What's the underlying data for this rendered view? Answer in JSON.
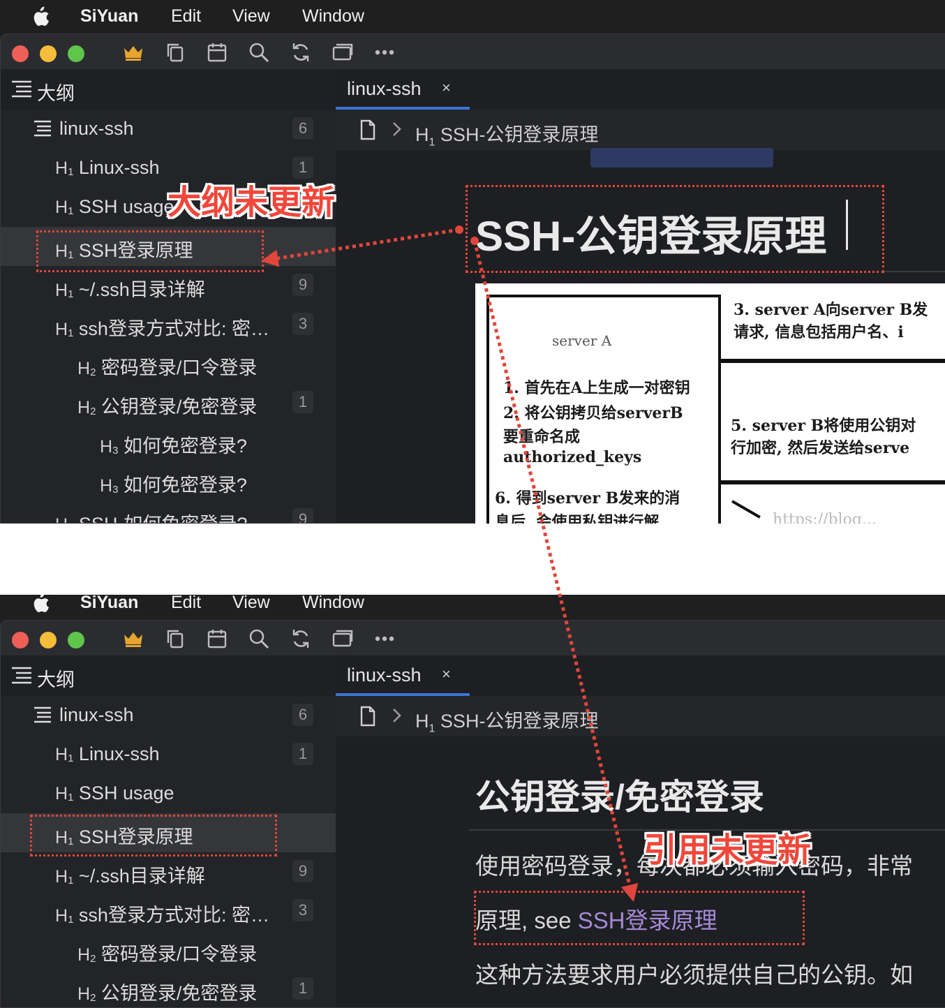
{
  "menubar": {
    "app_name": "SiYuan",
    "items": [
      "Edit",
      "View",
      "Window"
    ]
  },
  "toolbar": {
    "icons": [
      "crown-icon",
      "copy-icon",
      "calendar-icon",
      "search-icon",
      "sync-icon",
      "window-icon",
      "more-icon"
    ]
  },
  "sidebar": {
    "title": "大纲",
    "top_rows": [
      {
        "level": "doc",
        "label": "linux-ssh",
        "count": "6"
      },
      {
        "level": "H1",
        "label": "Linux-ssh",
        "count": "1"
      },
      {
        "level": "H1",
        "label": "SSH usage",
        "count": ""
      },
      {
        "level": "H1",
        "label": "SSH登录原理",
        "count": ""
      },
      {
        "level": "H1",
        "label": "~/.ssh目录详解",
        "count": "9"
      },
      {
        "level": "H1",
        "label": "ssh登录方式对比: 密…",
        "count": "3"
      },
      {
        "level": "H2",
        "label": "密码登录/口令登录",
        "count": ""
      },
      {
        "level": "H2",
        "label": "公钥登录/免密登录",
        "count": "1"
      },
      {
        "level": "H3",
        "label": "如何免密登录?",
        "count": ""
      },
      {
        "level": "H3",
        "label": "如何免密登录?",
        "count": ""
      },
      {
        "level": "H1",
        "label": "SSH-如何免密登录?",
        "count": "9"
      }
    ],
    "bottom_rows": [
      {
        "level": "doc",
        "label": "linux-ssh",
        "count": "6"
      },
      {
        "level": "H1",
        "label": "Linux-ssh",
        "count": "1"
      },
      {
        "level": "H1",
        "label": "SSH usage",
        "count": ""
      },
      {
        "level": "H1",
        "label": "SSH登录原理",
        "count": ""
      },
      {
        "level": "H1",
        "label": "~/.ssh目录详解",
        "count": "9"
      },
      {
        "level": "H1",
        "label": "ssh登录方式对比: 密…",
        "count": "3"
      },
      {
        "level": "H2",
        "label": "密码登录/口令登录",
        "count": ""
      },
      {
        "level": "H2",
        "label": "公钥登录/免密登录",
        "count": "1"
      }
    ]
  },
  "editor": {
    "tab_label": "linux-ssh",
    "tab_close": "×",
    "breadcrumb": "H1 SSH-公钥登录原理",
    "breadcrumb_level": "H",
    "breadcrumb_level_num": "1",
    "breadcrumb_text": "SSH-公钥登录原理",
    "top_heading": "SSH-公钥登录原理",
    "bottom_heading": "公钥登录/免密登录",
    "para1": "使用密码登录，每次都必须输入密码，非常",
    "para2_prefix": "原理, see ",
    "para2_ref": "SSH登录原理",
    "para3": "这种方法要求用户必须提供自己的公钥。如"
  },
  "figure": {
    "server_a": "server A",
    "step1": "1. 首先在A上生成一对密钥",
    "step2a": "2. 将公钥拷贝给serverB",
    "step2b": "要重命名成",
    "step2c": "authorized_keys",
    "step3a": "3. server A向server B发",
    "step3b": "请求, 信息包括用户名、i",
    "step5a": "5. server B将使用公钥对",
    "step5b": "行加密, 然后发送给serve",
    "step6a": "6. 得到server B发来的消",
    "step6b": "息后, 会使用私钥进行解",
    "watermark": "https://blog..."
  },
  "annotations": {
    "outline_not_updated": "大纲未更新",
    "ref_not_updated": "引用未更新"
  },
  "colors": {
    "accent": "#3b74d6",
    "annotation": "#e0473c",
    "reference": "#a58ad8"
  }
}
